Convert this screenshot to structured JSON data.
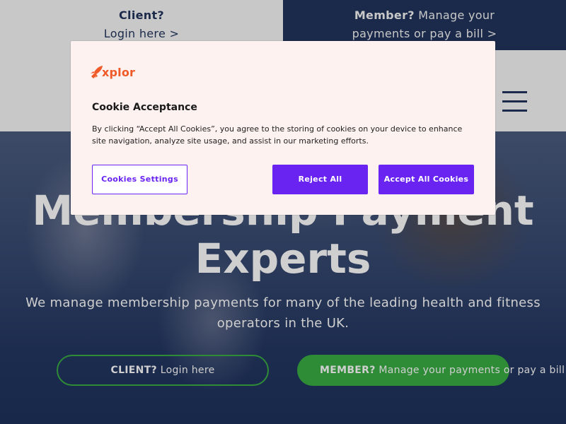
{
  "topbar": {
    "client_strong": "Client?",
    "client_link": "Login here >",
    "member_strong": "Member?",
    "member_text_1": " Manage your",
    "member_text_2": "payments or pay a bill >"
  },
  "header": {
    "menu_icon": "hamburger-menu-icon"
  },
  "hero": {
    "title_line_1": "Membership Payment",
    "title_line_2": "Experts",
    "subtitle": "We manage membership payments for many of the leading health and fitness operators in the UK.",
    "client_button_strong": "CLIENT?",
    "client_button_text": " Login here",
    "member_button_strong": "MEMBER?",
    "member_button_text": " Manage your payments or pay a bill"
  },
  "cookie": {
    "logo_text": "xplor",
    "logo_icon": "rocket-icon",
    "title": "Cookie Acceptance",
    "body": "By clicking “Accept All Cookies”, you agree to the storing of cookies on your device to enhance site navigation, analyze site usage, and assist in our marketing efforts.",
    "settings_label": "Cookies Settings",
    "reject_label": "Reject All",
    "accept_label": "Accept All Cookies"
  },
  "colors": {
    "navy": "#1b2a4a",
    "light_grey": "#c8c8c8",
    "green": "#2e8b36",
    "purple": "#6a24f2",
    "brand_orange": "#f05a28",
    "modal_bg": "#fdf2ef"
  }
}
